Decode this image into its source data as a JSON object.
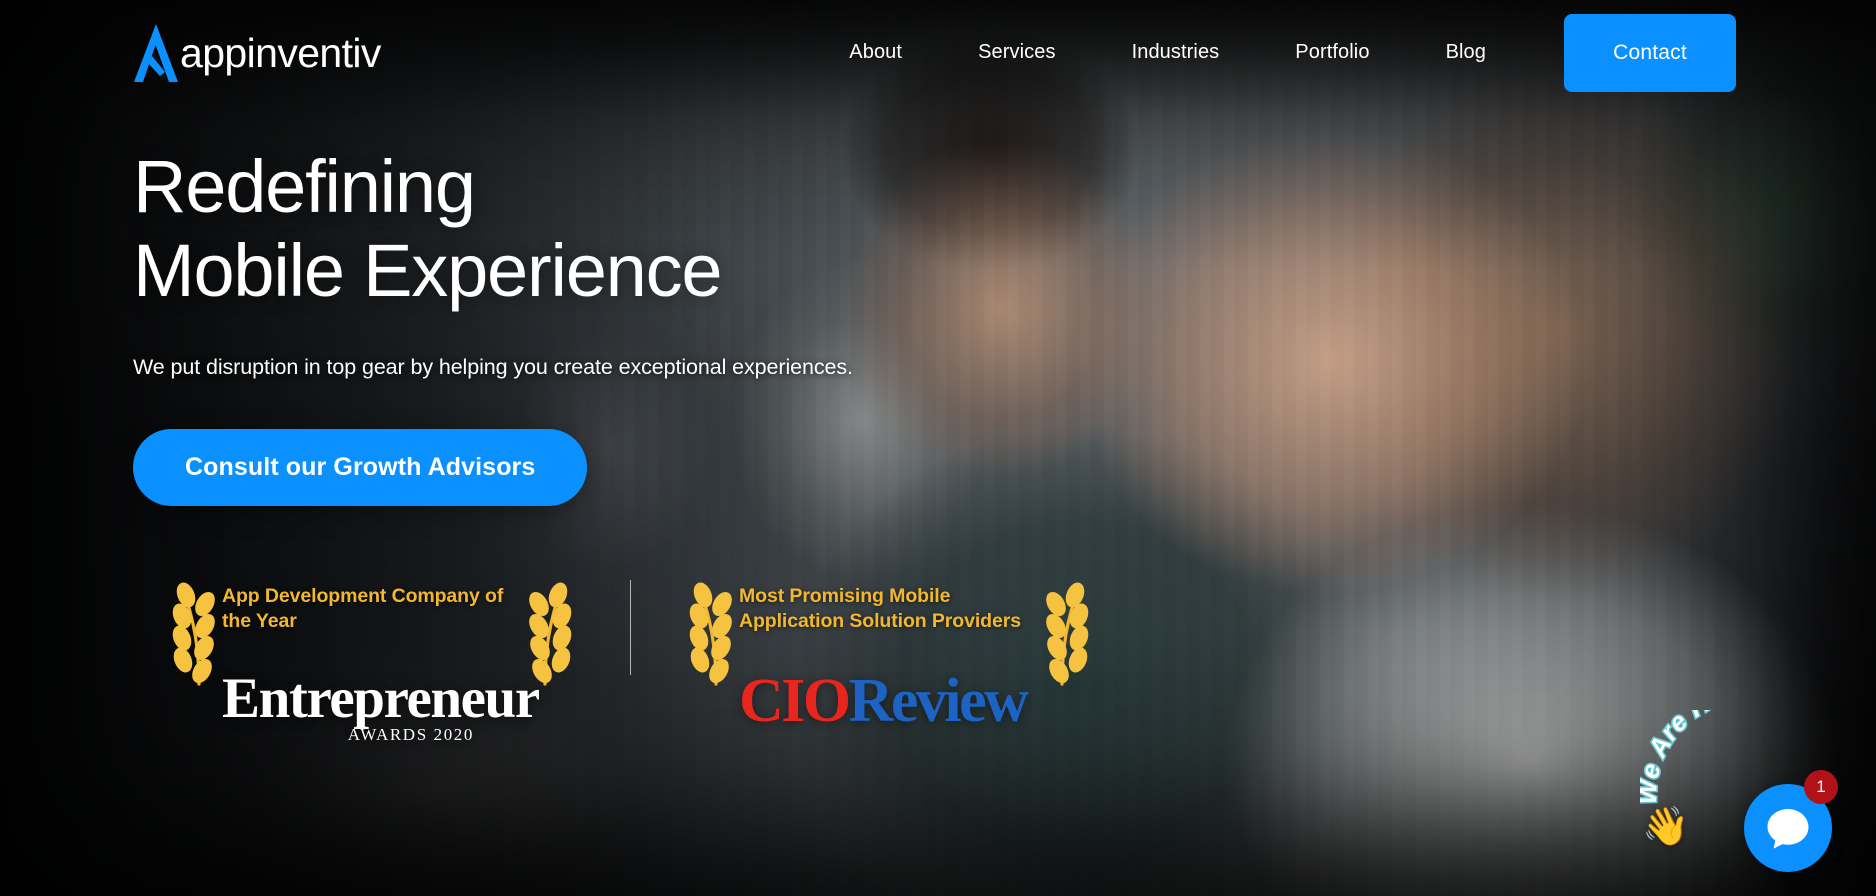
{
  "brand": {
    "logo_icon": "appinventiv-a-logo-icon",
    "name": "appinventiv",
    "accent_color": "#0a90ff",
    "award_gold": "#f2b72e"
  },
  "header": {
    "nav": [
      {
        "label": "About"
      },
      {
        "label": "Services"
      },
      {
        "label": "Industries"
      },
      {
        "label": "Portfolio"
      },
      {
        "label": "Blog"
      }
    ],
    "contact_label": "Contact"
  },
  "hero": {
    "headline_line1": "Redefining",
    "headline_line2": "Mobile Experience",
    "subheadline": "We put disruption in top gear by helping you create exceptional experiences.",
    "cta_label": "Consult our Growth Advisors"
  },
  "awards": [
    {
      "title": "App Development Company of the Year",
      "laurel_icon": "laurel-wreath-icon",
      "logo_kind": "entrepreneur",
      "logo_word": "Entrepreneur",
      "logo_sub": "AWARDS 2020"
    },
    {
      "title": "Most Promising Mobile Application Solution Providers",
      "laurel_icon": "laurel-wreath-icon",
      "logo_kind": "cioreview",
      "logo_word_part1": "CIO",
      "logo_word_part2": "Review"
    }
  ],
  "chat": {
    "prompt_text": "We Are Here!",
    "hand_icon": "waving-hand-icon",
    "bubble_icon": "chat-bubble-icon",
    "unread_count": "1",
    "badge_color": "#b01218"
  }
}
